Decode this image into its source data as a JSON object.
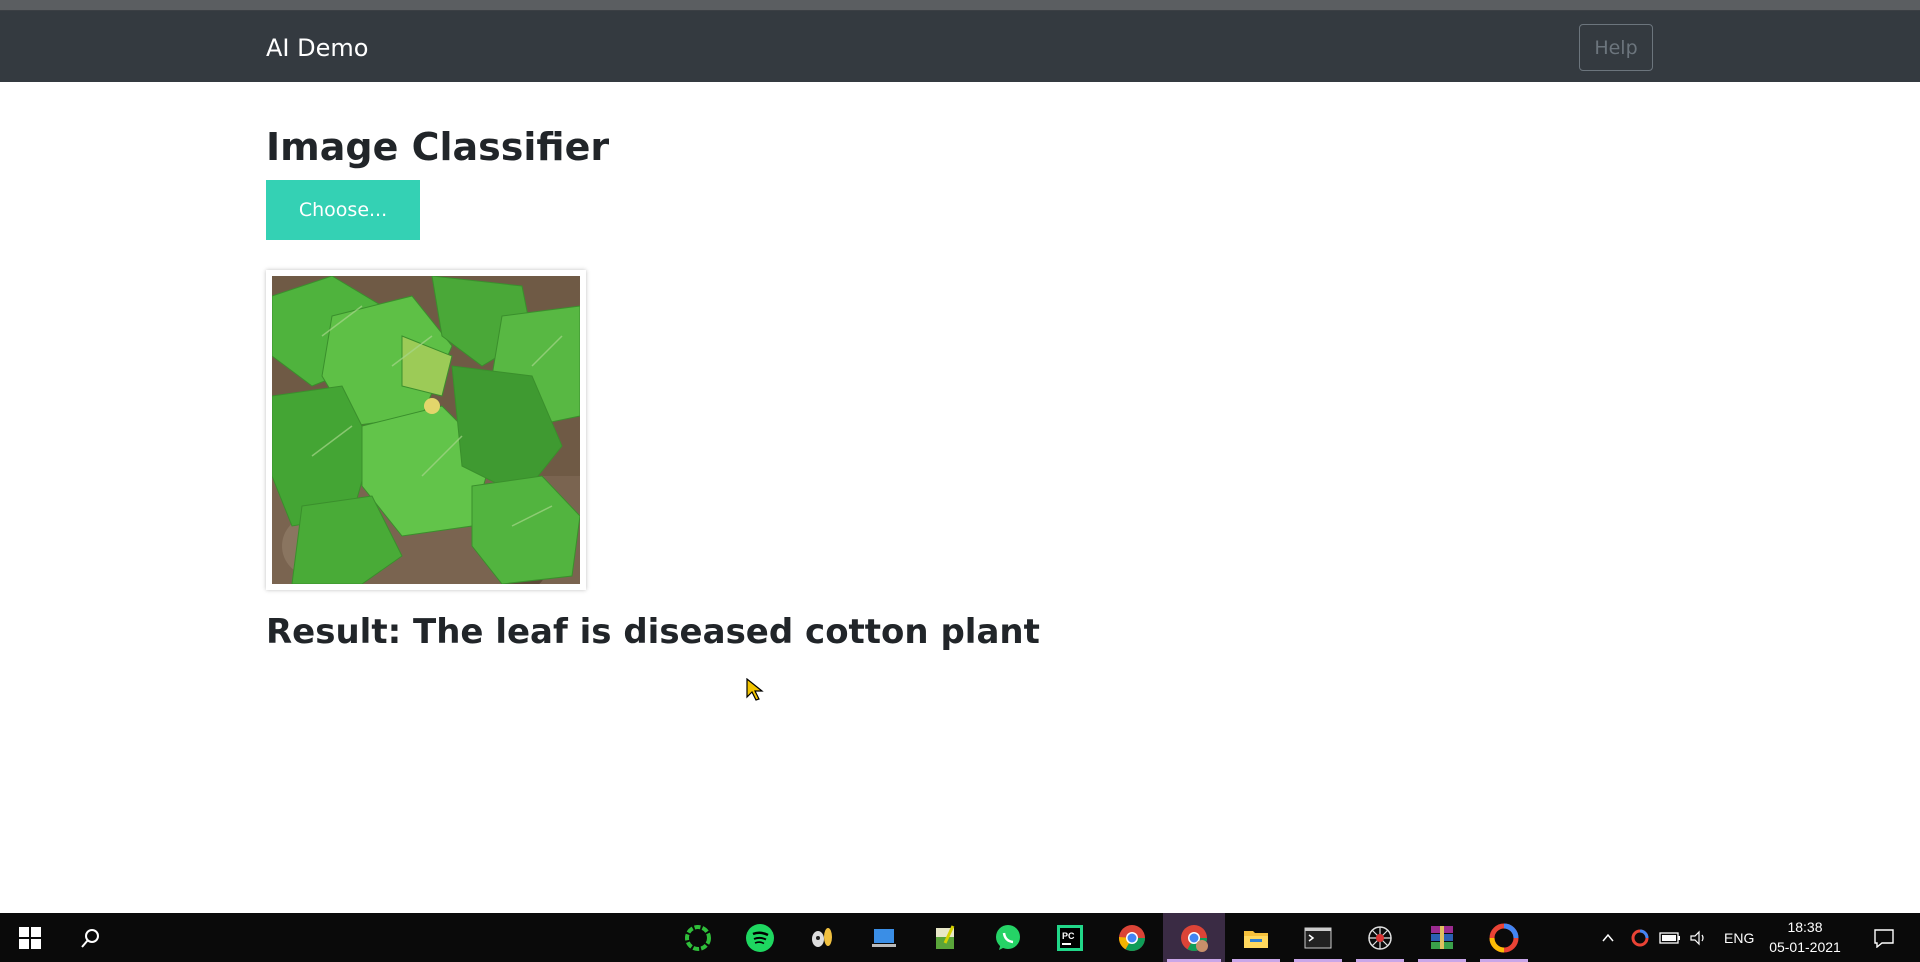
{
  "navbar": {
    "brand": "AI Demo",
    "help_label": "Help"
  },
  "main": {
    "title": "Image Classifier",
    "choose_label": "Choose...",
    "result_text": "Result: The leaf is diseased cotton plant"
  },
  "colors": {
    "navbar_bg": "#343a40",
    "choose_button": "#34d1b4",
    "taskbar_bg": "#0a0a0a"
  },
  "taskbar": {
    "apps": [
      "start-icon",
      "search-icon",
      "cortana-ring-icon",
      "spotify-icon",
      "app-icon",
      "laptop-icon",
      "notepad-icon",
      "whatsapp-icon",
      "pycharm-icon",
      "chrome-icon",
      "chrome-profile-icon",
      "file-explorer-icon",
      "terminal-icon",
      "network-icon",
      "winrar-icon",
      "photos-icon"
    ],
    "tray_lang": "ENG",
    "time": "18:38",
    "date": "05-01-2021"
  }
}
